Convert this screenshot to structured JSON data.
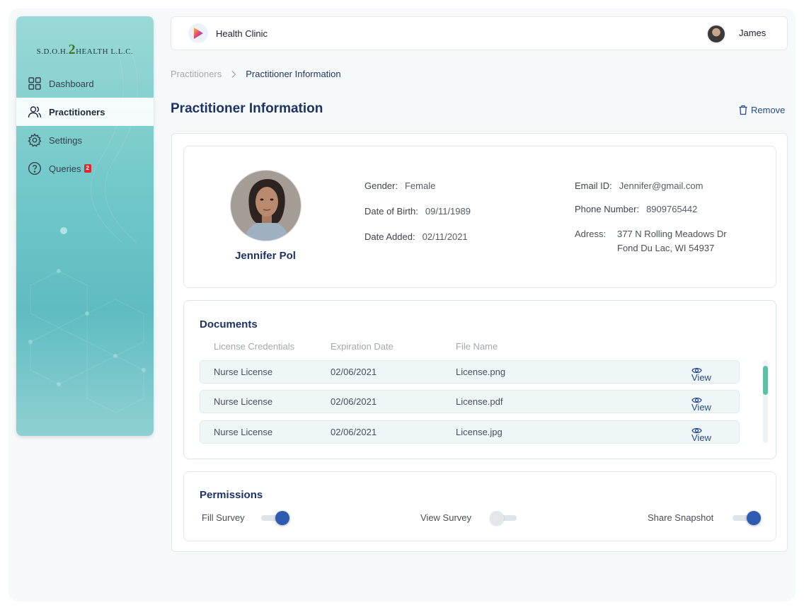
{
  "sidebar": {
    "logo_left": "S.D.O.H.",
    "logo_num": "2",
    "logo_right": "HEALTH L.L.C.",
    "items": [
      {
        "label": "Dashboard",
        "icon": "grid-icon"
      },
      {
        "label": "Practitioners",
        "icon": "users-icon",
        "active": true
      },
      {
        "label": "Settings",
        "icon": "gear-icon"
      },
      {
        "label": "Queries",
        "icon": "help-circle-icon",
        "badge": "2"
      }
    ]
  },
  "header": {
    "app_title": "Health Clinic",
    "user_name": "James"
  },
  "breadcrumb": {
    "parent": "Practitioners",
    "current": "Practitioner Information"
  },
  "page": {
    "title": "Practitioner Information",
    "remove_label": "Remove"
  },
  "profile": {
    "name": "Jennifer Pol",
    "gender_label": "Gender:",
    "gender": "Female",
    "dob_label": "Date of Birth:",
    "dob": "09/11/1989",
    "added_label": "Date Added:",
    "added": "02/11/2021",
    "email_label": "Email ID:",
    "email": "Jennifer@gmail.com",
    "phone_label": "Phone Number:",
    "phone": "8909765442",
    "address_label": "Adress:",
    "address_line1": "377 N Rolling Meadows Dr",
    "address_line2": "Fond Du Lac, WI 54937"
  },
  "documents": {
    "title": "Documents",
    "columns": [
      "License Credentials",
      "Expiration Date",
      "File Name"
    ],
    "view_label": "View",
    "rows": [
      {
        "credential": "Nurse License",
        "expiration": "02/06/2021",
        "file": "License.png"
      },
      {
        "credential": "Nurse License",
        "expiration": "02/06/2021",
        "file": "License.pdf"
      },
      {
        "credential": "Nurse License",
        "expiration": "02/06/2021",
        "file": "License.jpg"
      }
    ]
  },
  "permissions": {
    "title": "Permissions",
    "items": [
      {
        "label": "Fill Survey",
        "enabled": true
      },
      {
        "label": "View Survey",
        "enabled": false
      },
      {
        "label": "Share Snapshot",
        "enabled": true
      }
    ]
  },
  "colors": {
    "primary": "#1e3265",
    "accent": "#2c5bb1",
    "sidebar": "#73c8c9",
    "badge": "#e3242b",
    "scroll": "#5fbfa6"
  }
}
